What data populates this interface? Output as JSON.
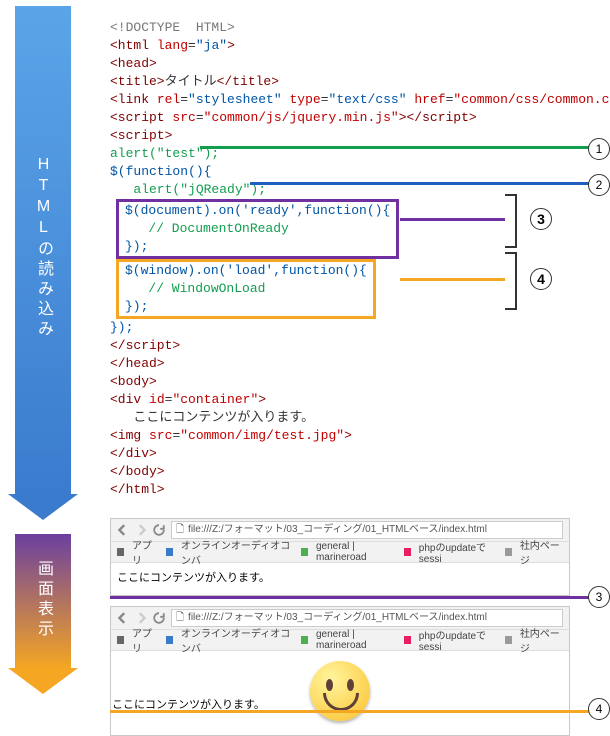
{
  "sidebar": {
    "label1": "HTMLの読み込み",
    "label2": "画面表示"
  },
  "code": {
    "doctype": "<!DOCTYPE  HTML>",
    "html_open": "<html",
    "attr_lang": "lang",
    "val_lang": "\"ja\"",
    "head_open": "<head>",
    "title_open": "<title>",
    "title_text": "タイトル",
    "title_close": "</title>",
    "link": "<link",
    "attr_rel": "rel",
    "val_rel": "\"stylesheet\"",
    "attr_type": "type",
    "val_type": "\"text/css\"",
    "attr_href": "href",
    "val_href": "\"common/css/common.css\"",
    "script_jq": "<script",
    "attr_src": "src",
    "val_jq": "\"common/js/jquery.min.js\"",
    "script_close": "></script>",
    "script_open": "<script>",
    "alert_test": "alert(\"test\");",
    "fn_open": "$(function(){",
    "alert_jq": "alert(\"jQReady\");",
    "doc_on": "$(document).on('ready',function(){",
    "doc_cmt": "// DocumentOnReady",
    "win_on": "$(window).on('load',function(){",
    "win_cmt": "// WindowOnLoad",
    "close_brace": "});",
    "script_end": "</script>",
    "head_close": "</head>",
    "body_open": "<body>",
    "div_open": "<div",
    "attr_id": "id",
    "val_id": "\"container\"",
    "content_text": "ここにコンテンツが入ります。",
    "img": "<img",
    "val_img": "\"common/img/test.jpg\"",
    "div_close": "</div>",
    "body_close": "</body>",
    "html_close": "</html>"
  },
  "markers": {
    "m1": "1",
    "m2": "2",
    "m3": "3",
    "m4": "4"
  },
  "browser": {
    "url": "file:///Z:/フォーマット/03_コーディング/01_HTMLベース/index.html",
    "apps": "アプリ",
    "bm1": "オンラインオーディオコンバ",
    "bm2": "general | marineroad",
    "bm3": "phpのupdateでsessi",
    "bm4": "社内ページ",
    "content": "ここにコンテンツが入ります。"
  }
}
